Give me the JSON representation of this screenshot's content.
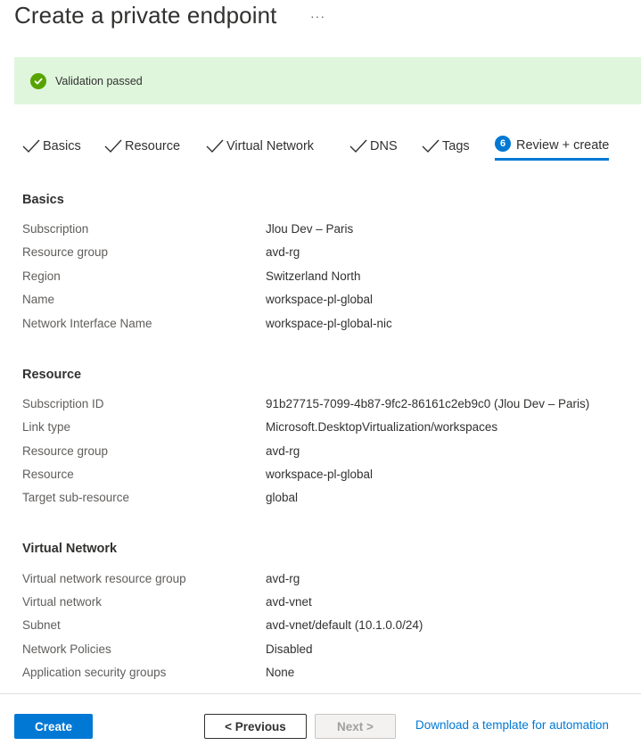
{
  "header": {
    "title": "Create a private endpoint",
    "more": "···"
  },
  "banner": {
    "text": "Validation passed",
    "color": "#57a300"
  },
  "tabs": [
    {
      "label": "Basics",
      "state": "done"
    },
    {
      "label": "Resource",
      "state": "done"
    },
    {
      "label": "Virtual Network",
      "state": "done"
    },
    {
      "label": "DNS",
      "state": "done"
    },
    {
      "label": "Tags",
      "state": "done"
    },
    {
      "label": "Review + create",
      "state": "active",
      "step": "6"
    }
  ],
  "sections": {
    "basics": {
      "title": "Basics",
      "rows": [
        {
          "label": "Subscription",
          "value": "Jlou Dev – Paris"
        },
        {
          "label": "Resource group",
          "value": "avd-rg"
        },
        {
          "label": "Region",
          "value": "Switzerland North"
        },
        {
          "label": "Name",
          "value": "workspace-pl-global"
        },
        {
          "label": "Network Interface Name",
          "value": "workspace-pl-global-nic"
        }
      ]
    },
    "resource": {
      "title": "Resource",
      "rows": [
        {
          "label": "Subscription ID",
          "value": "91b27715-7099-4b87-9fc2-86161c2eb9c0 (Jlou Dev – Paris)"
        },
        {
          "label": "Link type",
          "value": "Microsoft.DesktopVirtualization/workspaces"
        },
        {
          "label": "Resource group",
          "value": "avd-rg"
        },
        {
          "label": "Resource",
          "value": "workspace-pl-global"
        },
        {
          "label": "Target sub-resource",
          "value": "global"
        }
      ]
    },
    "vnet": {
      "title": "Virtual Network",
      "rows": [
        {
          "label": "Virtual network resource group",
          "value": "avd-rg"
        },
        {
          "label": "Virtual network",
          "value": "avd-vnet"
        },
        {
          "label": "Subnet",
          "value": "avd-vnet/default (10.1.0.0/24)"
        },
        {
          "label": "Network Policies",
          "value": "Disabled"
        },
        {
          "label": "Application security groups",
          "value": "None"
        }
      ]
    }
  },
  "footer": {
    "create_label": "Create",
    "previous_label": "< Previous",
    "next_label": "Next >",
    "template_link": "Download a template for automation"
  },
  "colors": {
    "accent": "#0078d4",
    "success_bg": "#dff6dd"
  }
}
